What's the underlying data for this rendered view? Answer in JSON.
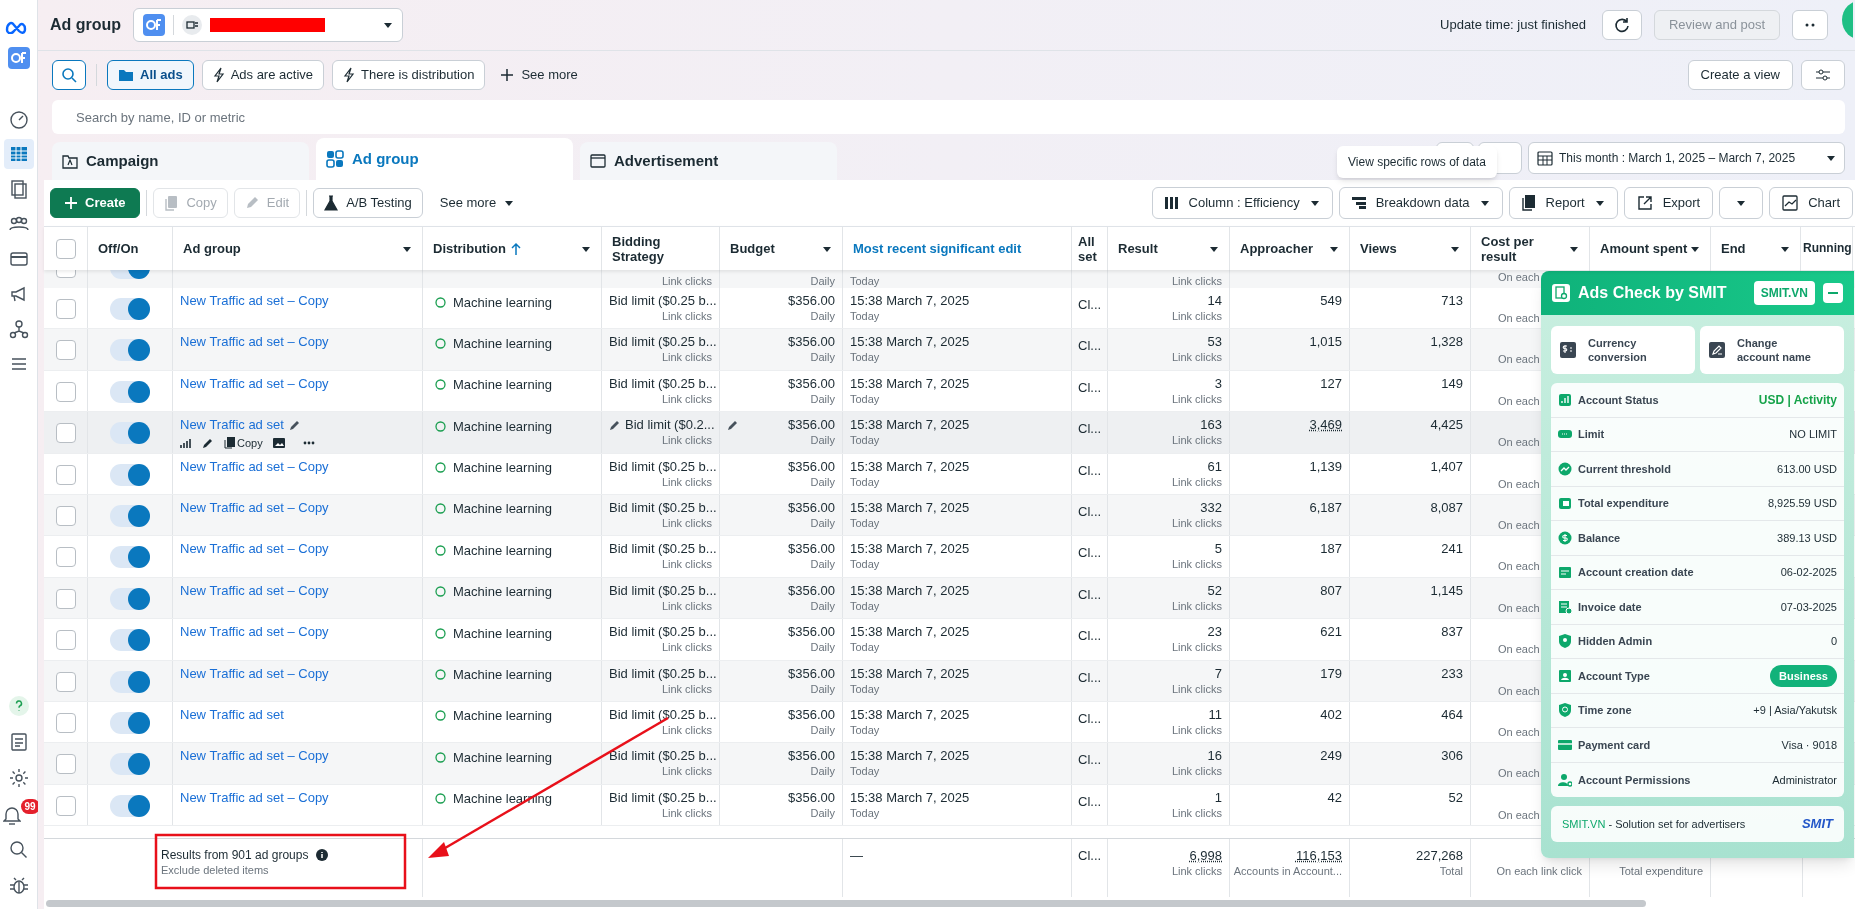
{
  "header": {
    "title": "Ad group",
    "update_time": "Update time: just finished",
    "review_button": "Review and post"
  },
  "filters": [
    {
      "kind": "folder",
      "label": "All ads",
      "selected": true
    },
    {
      "kind": "bolt",
      "label": "Ads are active",
      "selected": false
    },
    {
      "kind": "bolt",
      "label": "There is distribution",
      "selected": false
    }
  ],
  "see_more": "See more",
  "create_view": "Create a view",
  "search": {
    "placeholder": "Search by name, ID or metric"
  },
  "tabs": [
    {
      "kind": "campaign",
      "label": "Campaign",
      "selected": false
    },
    {
      "kind": "adgroup",
      "label": "Ad group",
      "selected": true
    },
    {
      "kind": "ad",
      "label": "Advertisement",
      "selected": false
    }
  ],
  "date_range": "This month : March 1, 2025 – March 7, 2025",
  "tooltip": "View specific rows of data",
  "toolbar_left": [
    {
      "kind": "create",
      "label": "Create",
      "disabled": false
    },
    {
      "kind": "copy",
      "label": "Copy",
      "disabled": true
    },
    {
      "kind": "edit",
      "label": "Edit",
      "disabled": true
    },
    {
      "kind": "ab",
      "label": "A/B Testing",
      "disabled": false
    },
    {
      "kind": "more",
      "label": "See more",
      "disabled": false
    }
  ],
  "toolbar_right": [
    {
      "kind": "column",
      "label": "Column : Efficiency"
    },
    {
      "kind": "breakdown",
      "label": "Breakdown data"
    },
    {
      "kind": "report",
      "label": "Report"
    },
    {
      "kind": "export",
      "label": "Export"
    },
    {
      "kind": "dropdown"
    },
    {
      "kind": "chart",
      "label": "Chart"
    }
  ],
  "table": {
    "columns": [
      {
        "kind": "checkbox",
        "checked": false
      },
      {
        "label": "Off/On",
        "menu": false,
        "highlight": false,
        "sorted": false
      },
      {
        "label": "Ad group",
        "menu": true,
        "highlight": false,
        "sorted": false
      },
      {
        "label": "Distribution",
        "menu": true,
        "highlight": false,
        "sorted": true
      },
      {
        "label": "Bidding Strategy",
        "menu": false,
        "highlight": false,
        "sorted": false
      },
      {
        "label": "Budget",
        "menu": true,
        "highlight": false,
        "sorted": false
      },
      {
        "label": "Most recent significant edit",
        "menu": false,
        "highlight": true,
        "sorted": false
      },
      {
        "label": "All set",
        "menu": false,
        "highlight": false,
        "sorted": false
      },
      {
        "label": "Result",
        "menu": true,
        "highlight": false,
        "sorted": false
      },
      {
        "label": "Approacher",
        "menu": true,
        "highlight": false,
        "sorted": false
      },
      {
        "label": "Views",
        "menu": true,
        "highlight": false,
        "sorted": false
      },
      {
        "label": "Cost per result",
        "menu": true,
        "highlight": false,
        "sorted": false
      },
      {
        "label": "Amount spent",
        "menu": true,
        "highlight": false,
        "sorted": false
      },
      {
        "label": "End",
        "menu": true,
        "highlight": false,
        "sorted": false
      },
      {
        "label": "Running",
        "highlight": false
      }
    ],
    "rows": [
      {
        "partial": true,
        "checked": false,
        "on": true,
        "hovered": false,
        "bid_sub": "Link clicks",
        "budget_sub": "Daily",
        "edit_sub": "Today",
        "result_sub": "Link clicks",
        "cost_sub": "On each"
      },
      {
        "checked": false,
        "on": true,
        "hovered": false,
        "name": "New Traffic ad set – Copy",
        "distribution": "Machine learning",
        "bid": "Bid limit ($0.25 b...",
        "bid_sub": "Link clicks",
        "budget": "$356.00",
        "budget_sub": "Daily",
        "edit": "15:38 March 7, 2025",
        "edit_sub": "Today",
        "allo": "Cl...",
        "result": "14",
        "result_sub": "Link clicks",
        "approacher": "549",
        "views": "713",
        "cost_sub": "On each"
      },
      {
        "checked": false,
        "on": true,
        "hovered": false,
        "name": "New Traffic ad set – Copy",
        "distribution": "Machine learning",
        "bid": "Bid limit ($0.25 b...",
        "bid_sub": "Link clicks",
        "budget": "$356.00",
        "budget_sub": "Daily",
        "edit": "15:38 March 7, 2025",
        "edit_sub": "Today",
        "allo": "Cl...",
        "result": "53",
        "result_sub": "Link clicks",
        "approacher": "1,015",
        "views": "1,328",
        "cost_sub": "On each"
      },
      {
        "checked": false,
        "on": true,
        "hovered": false,
        "name": "New Traffic ad set – Copy",
        "distribution": "Machine learning",
        "bid": "Bid limit ($0.25 b...",
        "bid_sub": "Link clicks",
        "budget": "$356.00",
        "budget_sub": "Daily",
        "edit": "15:38 March 7, 2025",
        "edit_sub": "Today",
        "allo": "Cl...",
        "result": "3",
        "result_sub": "Link clicks",
        "approacher": "127",
        "views": "149",
        "cost_sub": "On each"
      },
      {
        "checked": false,
        "on": true,
        "hovered": true,
        "name": "New Traffic ad set",
        "action_copy": "Copy",
        "distribution": "Machine learning",
        "bid": "Bid limit ($0.2...",
        "bid_sub": "Link clicks",
        "budget": "$356.00",
        "budget_sub": "Daily",
        "edit": "15:38 March 7, 2025",
        "edit_sub": "Today",
        "allo": "Cl...",
        "result": "163",
        "result_sub": "Link clicks",
        "approacher": "3,469",
        "views": "4,425",
        "cost_sub": "On each"
      },
      {
        "checked": false,
        "on": true,
        "hovered": false,
        "name": "New Traffic ad set – Copy",
        "distribution": "Machine learning",
        "bid": "Bid limit ($0.25 b...",
        "bid_sub": "Link clicks",
        "budget": "$356.00",
        "budget_sub": "Daily",
        "edit": "15:38 March 7, 2025",
        "edit_sub": "Today",
        "allo": "Cl...",
        "result": "61",
        "result_sub": "Link clicks",
        "approacher": "1,139",
        "views": "1,407",
        "cost_sub": "On each"
      },
      {
        "checked": false,
        "on": true,
        "hovered": false,
        "name": "New Traffic ad set – Copy",
        "distribution": "Machine learning",
        "bid": "Bid limit ($0.25 b...",
        "bid_sub": "Link clicks",
        "budget": "$356.00",
        "budget_sub": "Daily",
        "edit": "15:38 March 7, 2025",
        "edit_sub": "Today",
        "allo": "Cl...",
        "result": "332",
        "result_sub": "Link clicks",
        "approacher": "6,187",
        "views": "8,087",
        "cost_sub": "On each"
      },
      {
        "checked": false,
        "on": true,
        "hovered": false,
        "name": "New Traffic ad set – Copy",
        "distribution": "Machine learning",
        "bid": "Bid limit ($0.25 b...",
        "bid_sub": "Link clicks",
        "budget": "$356.00",
        "budget_sub": "Daily",
        "edit": "15:38 March 7, 2025",
        "edit_sub": "Today",
        "allo": "Cl...",
        "result": "5",
        "result_sub": "Link clicks",
        "approacher": "187",
        "views": "241",
        "cost_sub": "On each"
      },
      {
        "checked": false,
        "on": true,
        "hovered": false,
        "name": "New Traffic ad set – Copy",
        "distribution": "Machine learning",
        "bid": "Bid limit ($0.25 b...",
        "bid_sub": "Link clicks",
        "budget": "$356.00",
        "budget_sub": "Daily",
        "edit": "15:38 March 7, 2025",
        "edit_sub": "Today",
        "allo": "Cl...",
        "result": "52",
        "result_sub": "Link clicks",
        "approacher": "807",
        "views": "1,145",
        "cost_sub": "On each"
      },
      {
        "checked": false,
        "on": true,
        "hovered": false,
        "name": "New Traffic ad set – Copy",
        "distribution": "Machine learning",
        "bid": "Bid limit ($0.25 b...",
        "bid_sub": "Link clicks",
        "budget": "$356.00",
        "budget_sub": "Daily",
        "edit": "15:38 March 7, 2025",
        "edit_sub": "Today",
        "allo": "Cl...",
        "result": "23",
        "result_sub": "Link clicks",
        "approacher": "621",
        "views": "837",
        "cost_sub": "On each"
      },
      {
        "checked": false,
        "on": true,
        "hovered": false,
        "name": "New Traffic ad set – Copy",
        "distribution": "Machine learning",
        "bid": "Bid limit ($0.25 b...",
        "bid_sub": "Link clicks",
        "budget": "$356.00",
        "budget_sub": "Daily",
        "edit": "15:38 March 7, 2025",
        "edit_sub": "Today",
        "allo": "Cl...",
        "result": "7",
        "result_sub": "Link clicks",
        "approacher": "179",
        "views": "233",
        "cost_sub": "On each"
      },
      {
        "checked": false,
        "on": true,
        "hovered": false,
        "name": "New Traffic ad set",
        "distribution": "Machine learning",
        "bid": "Bid limit ($0.25 b...",
        "bid_sub": "Link clicks",
        "budget": "$356.00",
        "budget_sub": "Daily",
        "edit": "15:38 March 7, 2025",
        "edit_sub": "Today",
        "allo": "Cl...",
        "result": "11",
        "result_sub": "Link clicks",
        "approacher": "402",
        "views": "464",
        "cost_sub": "On each"
      },
      {
        "checked": false,
        "on": true,
        "hovered": false,
        "name": "New Traffic ad set – Copy",
        "distribution": "Machine learning",
        "bid": "Bid limit ($0.25 b...",
        "bid_sub": "Link clicks",
        "budget": "$356.00",
        "budget_sub": "Daily",
        "edit": "15:38 March 7, 2025",
        "edit_sub": "Today",
        "allo": "Cl...",
        "result": "16",
        "result_sub": "Link clicks",
        "approacher": "249",
        "views": "306",
        "cost_sub": "On each"
      },
      {
        "checked": false,
        "on": true,
        "hovered": false,
        "name": "New Traffic ad set – Copy",
        "distribution": "Machine learning",
        "bid": "Bid limit ($0.25 b...",
        "bid_sub": "Link clicks",
        "budget": "$356.00",
        "budget_sub": "Daily",
        "edit": "15:38 March 7, 2025",
        "edit_sub": "Today",
        "allo": "Cl...",
        "result": "1",
        "result_sub": "Link clicks",
        "approacher": "42",
        "views": "52",
        "cost_sub": "On each"
      }
    ],
    "footer": {
      "results": "Results from 901 ad groups",
      "note": "Exclude deleted items",
      "edit": "—",
      "allo": "Cl...",
      "result": "6,998",
      "result_sub": "Link clicks",
      "approacher": "116,153",
      "approacher_sub": "Accounts in Account...",
      "views": "227,268",
      "views_sub": "Total",
      "cost_sub": "On each link click",
      "amount_sub": "Total expenditure"
    }
  },
  "panel": {
    "title": "Ads Check by SMIT",
    "site_button": "SMIT.VN",
    "actions": [
      {
        "kind": "currency",
        "label": "Currency conversion"
      },
      {
        "kind": "rename",
        "label": "Change account name"
      }
    ],
    "rows": [
      {
        "kind": "status",
        "label": "Account Status",
        "value": "USD | Activity"
      },
      {
        "kind": "limit",
        "label": "Limit",
        "value": "NO LIMIT"
      },
      {
        "kind": "threshold",
        "label": "Current threshold",
        "value": "613.00 USD"
      },
      {
        "kind": "spend",
        "label": "Total expenditure",
        "value": "8,925.59 USD"
      },
      {
        "kind": "balance",
        "label": "Balance",
        "value": "389.13 USD"
      },
      {
        "kind": "created",
        "label": "Account creation date",
        "value": "06-02-2025"
      },
      {
        "kind": "invoice",
        "label": "Invoice date",
        "value": "07-03-2025"
      },
      {
        "kind": "admin",
        "label": "Hidden Admin",
        "value": "0"
      },
      {
        "kind": "type",
        "label": "Account Type",
        "value": "Business"
      },
      {
        "kind": "timezone",
        "label": "Time zone",
        "value": "+9 | Asia/Yakutsk"
      },
      {
        "kind": "card",
        "label": "Payment card",
        "value": "Visa · 9018"
      },
      {
        "kind": "permissions",
        "label": "Account Permissions",
        "value": "Administrator"
      }
    ],
    "footer_brand": "SMIT.VN",
    "footer_text": "- Solution set for advertisers",
    "logo": "SMIT"
  },
  "sidebar": {
    "badge": "99"
  }
}
